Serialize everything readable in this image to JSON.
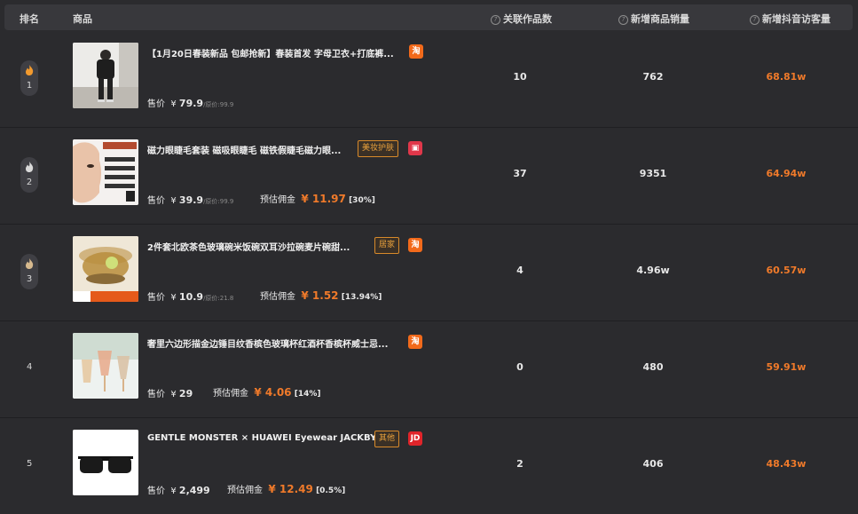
{
  "header": {
    "rank": "排名",
    "product": "商品",
    "related_works": "关联作品数",
    "new_sales": "新增商品销量",
    "new_visits": "新增抖音访客量"
  },
  "rows": [
    {
      "rank": "1",
      "title": "【1月20日春装新品 包邮抢新】春装首发 字母卫衣+打底裤...",
      "tag": "",
      "shop": "淘",
      "price_label": "售价",
      "currency": "¥",
      "price": "79.9",
      "orig_price": "/原价:99.9",
      "commission_label": "",
      "commission": "",
      "commission_pct": "",
      "related_works": "10",
      "new_sales": "762",
      "new_visits": "68.81w"
    },
    {
      "rank": "2",
      "title": "磁力眼睫毛套装 磁吸眼睫毛 磁铁假睫毛磁力眼...",
      "tag": "美妆护肤",
      "shop": "▣",
      "price_label": "售价",
      "currency": "¥",
      "price": "39.9",
      "orig_price": "/原价:99.9",
      "commission_label": "预估佣金",
      "commission": "11.97",
      "commission_pct": "[30%]",
      "related_works": "37",
      "new_sales": "9351",
      "new_visits": "64.94w"
    },
    {
      "rank": "3",
      "title": "2件套北欧茶色玻璃碗米饭碗双耳沙拉碗麦片碗甜...",
      "tag": "居家",
      "shop": "淘",
      "price_label": "售价",
      "currency": "¥",
      "price": "10.9",
      "orig_price": "/原价:21.8",
      "commission_label": "预估佣金",
      "commission": "1.52",
      "commission_pct": "[13.94%]",
      "related_works": "4",
      "new_sales": "4.96w",
      "new_visits": "60.57w"
    },
    {
      "rank": "4",
      "title": "奢里六边形描金边锤目纹香槟色玻璃杯红酒杯香槟杯威士忌...",
      "tag": "",
      "shop": "淘",
      "price_label": "售价",
      "currency": "¥",
      "price": "29",
      "orig_price": "",
      "commission_label": "预估佣金",
      "commission": "4.06",
      "commission_pct": "[14%]",
      "related_works": "0",
      "new_sales": "480",
      "new_visits": "59.91w"
    },
    {
      "rank": "5",
      "title": "GENTLE MONSTER × HUAWEI Eyewear JACKBYE...",
      "tag": "其他",
      "shop": "JD",
      "price_label": "售价",
      "currency": "¥",
      "price": "2,499",
      "orig_price": "",
      "commission_label": "预估佣金",
      "commission": "12.49",
      "commission_pct": "[0.5%]",
      "related_works": "2",
      "new_sales": "406",
      "new_visits": "48.43w"
    }
  ],
  "icons": {
    "help": "help-circle-icon",
    "rank1": "flame-icon",
    "rank2": "drop-icon",
    "rank3": "drop-icon",
    "taobao": "taobao-icon",
    "tmall": "tmall-icon",
    "jd": "jd-icon"
  },
  "colors": {
    "accent": "#f07a2a",
    "tag_border": "#d88a2a",
    "taobao": "#f26a1b",
    "tmall": "#e0374a",
    "jd": "#e0242a",
    "gold": "#f29a2e",
    "silver": "#d9d9d9",
    "bronze": "#d6b98e"
  }
}
